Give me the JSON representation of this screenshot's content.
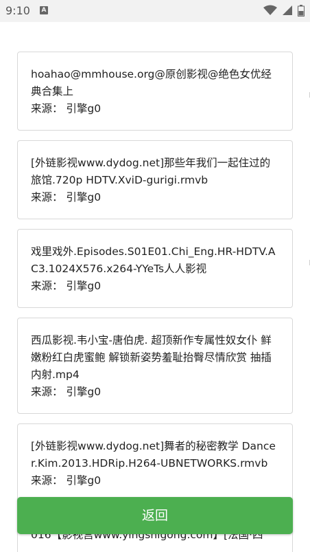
{
  "status_bar": {
    "time": "9:10",
    "notification_icon": "A",
    "icons": [
      "wifi-icon",
      "signal-icon",
      "battery-icon"
    ]
  },
  "results": [
    {
      "title": "hoahao@mmhouse.org@原创影视@绝色女优经典合集上",
      "source": "来源：  引擎g0"
    },
    {
      "title": "[外链影视www.dydog.net]那些年我们一起住过的旅馆.720p HDTV.XviD-gurigi.rmvb",
      "source": "来源：  引擎g0"
    },
    {
      "title": "戏里戏外.Episodes.S01E01.Chi_Eng.HR-HDTV.AC3.1024X576.x264-YYeTs人人影视",
      "source": "来源：  引擎g0"
    },
    {
      "title": "西瓜影视.韦小宝-唐伯虎. 超顶新作专属性奴女仆 鲜嫩粉红白虎蜜鲍 解锁新姿势羞耻抬臀尽情欣赏 抽插内射.mp4",
      "source": "来源：  引擎g0"
    },
    {
      "title": "[外链影视www.dydog.net]舞者的秘密教学 Dancer.Kim.2013.HDRip.H264-UBNETWORKS.rmvb",
      "source": "来源：  引擎g0"
    },
    {
      "title": "016【影视宫www.yingshigong.com】[法国·四",
      "source": ""
    }
  ],
  "back_button": {
    "label": "返回"
  },
  "colors": {
    "accent": "#4caf50",
    "border": "#d8d8d8",
    "status_bar_bg": "#f2f2f2"
  }
}
